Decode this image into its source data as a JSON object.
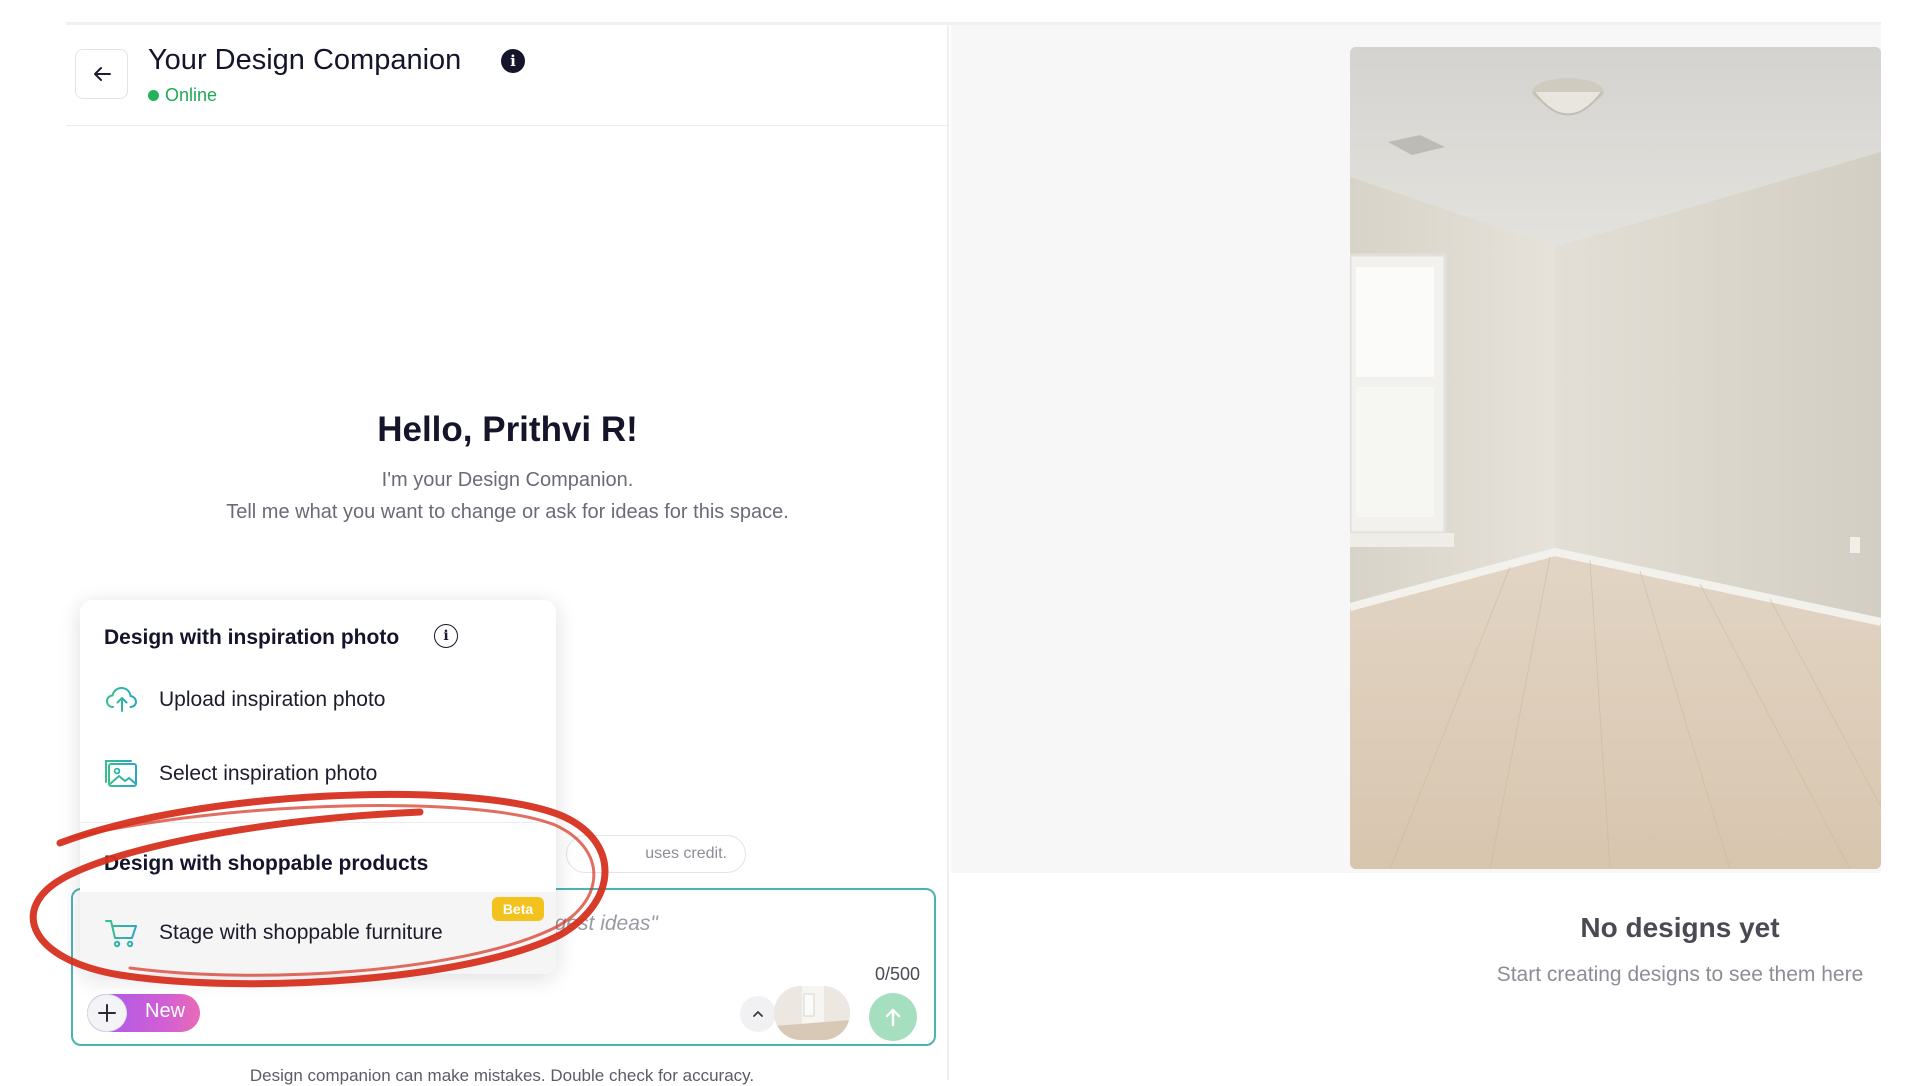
{
  "header": {
    "title": "Your Design Companion",
    "status": "Online",
    "info_glyph": "i",
    "back_icon": "arrow-left-icon"
  },
  "greeting": {
    "title": "Hello, Prithvi R!",
    "line1": "I'm your Design Companion.",
    "line2": "Tell me what you want to change or ask for ideas for this space."
  },
  "popup": {
    "section1_title": "Design with inspiration photo",
    "section1_info": "i",
    "items1": [
      {
        "label": "Upload inspiration photo",
        "icon": "cloud-upload-icon"
      },
      {
        "label": "Select inspiration photo",
        "icon": "images-icon"
      }
    ],
    "section2_title": "Design with shoppable products",
    "items2": [
      {
        "label": "Stage with shoppable furniture",
        "icon": "cart-icon",
        "badge": "Beta"
      }
    ]
  },
  "credit_chip": "uses credit.",
  "input": {
    "placeholder_visible": "ggest ideas\"",
    "counter": "0/500",
    "new_label": "New"
  },
  "disclaimer": "Design companion can make mistakes. Double check for accuracy.",
  "gallery": {
    "empty_title": "No designs yet",
    "empty_subtitle": "Start creating designs to see them here"
  },
  "colors": {
    "online": "#22b35a",
    "input_border": "#4cb3b3",
    "send_button": "#a6dfc0",
    "beta_badge": "#f4c21c",
    "annotation": "#d6301e"
  }
}
